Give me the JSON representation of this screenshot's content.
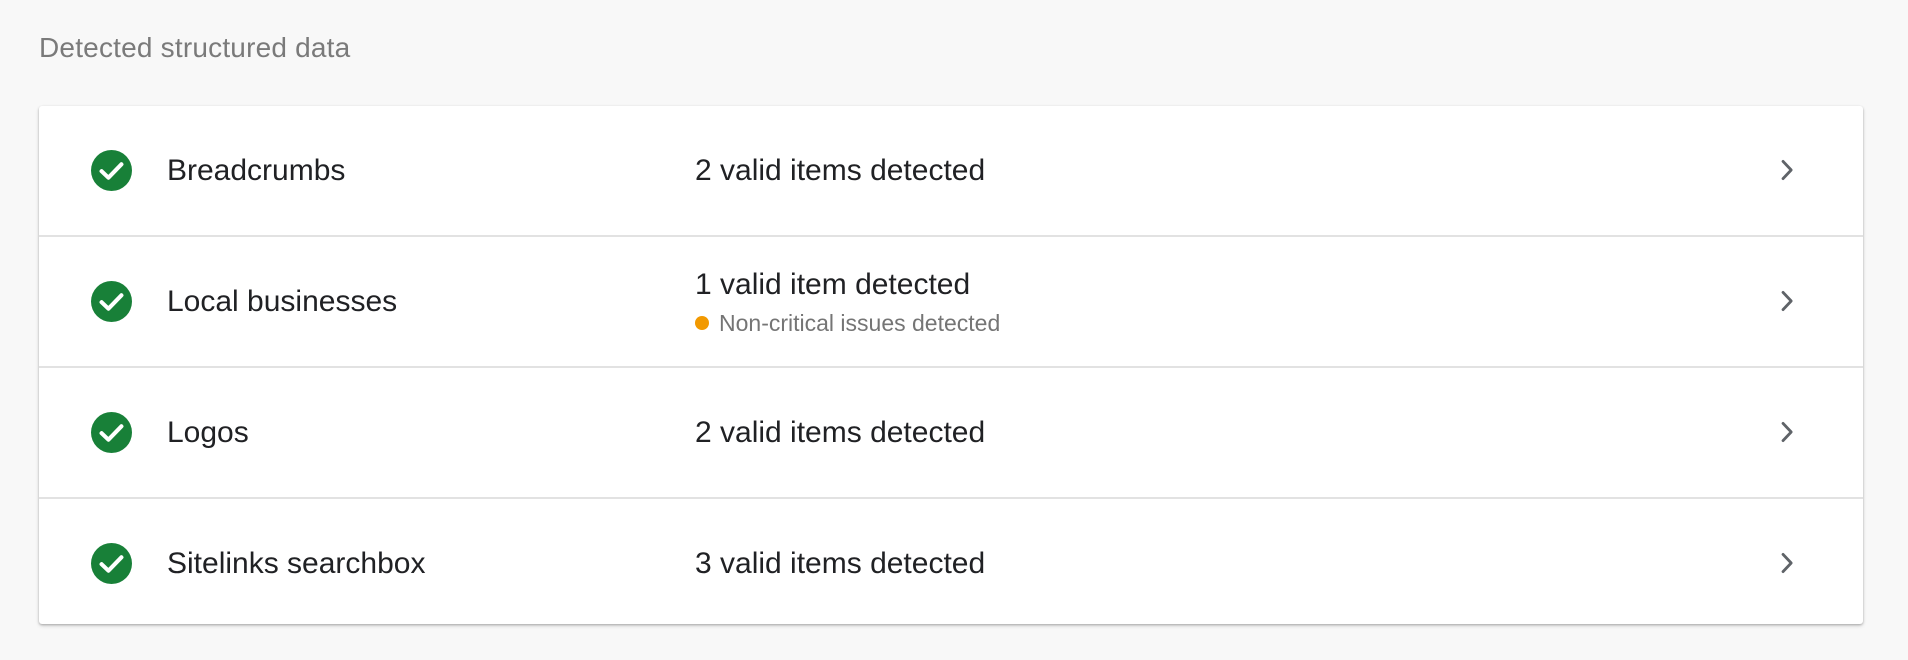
{
  "section": {
    "title": "Detected structured data"
  },
  "colors": {
    "success": "#188038",
    "warning": "#f29900",
    "chevron": "#5f6368"
  },
  "items": [
    {
      "name": "Breadcrumbs",
      "status": "2 valid items detected",
      "note": "",
      "icon": "check-circle-icon"
    },
    {
      "name": "Local businesses",
      "status": "1 valid item detected",
      "note": "Non-critical issues detected",
      "icon": "check-circle-icon"
    },
    {
      "name": "Logos",
      "status": "2 valid items detected",
      "note": "",
      "icon": "check-circle-icon"
    },
    {
      "name": "Sitelinks searchbox",
      "status": "3 valid items detected",
      "note": "",
      "icon": "check-circle-icon"
    }
  ]
}
